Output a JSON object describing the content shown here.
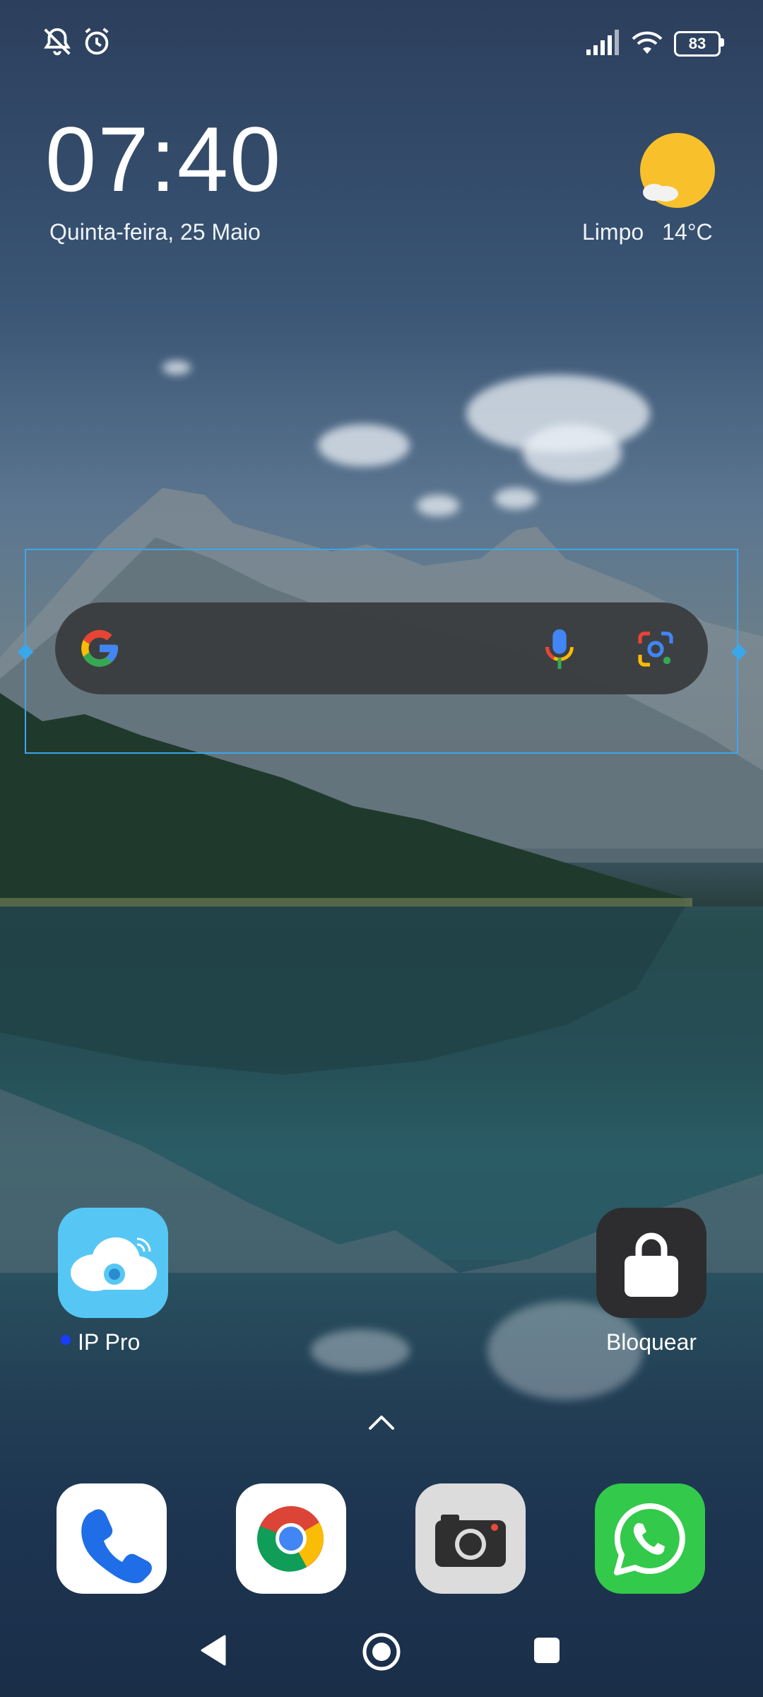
{
  "status_bar": {
    "left_icons": [
      "notifications-off-icon",
      "alarm-icon"
    ],
    "right_icons": [
      "signal-icon",
      "wifi-icon",
      "battery-icon"
    ],
    "battery_level": "83"
  },
  "clock_widget": {
    "time": "07:40",
    "date": "Quinta-feira, 25 Maio",
    "weather_condition": "Limpo",
    "temperature": "14°C",
    "weather_icon": "sun-with-cloud-icon"
  },
  "search_widget": {
    "logo": "google-g-icon",
    "voice_icon": "microphone-icon",
    "lens_icon": "google-lens-icon",
    "colors": {
      "blue": "#4285F4",
      "red": "#EA4335",
      "yellow": "#FBBC05",
      "green": "#34A853"
    }
  },
  "home_apps": [
    {
      "label": "IP Pro",
      "icon": "cloud-camera-icon",
      "has_new_dot": true
    },
    {
      "label": "Bloquear",
      "icon": "lock-icon"
    }
  ],
  "dock": [
    {
      "name": "Phone",
      "icon": "phone-icon"
    },
    {
      "name": "Chrome",
      "icon": "chrome-icon"
    },
    {
      "name": "Camera",
      "icon": "camera-icon"
    },
    {
      "name": "WhatsApp",
      "icon": "whatsapp-icon"
    }
  ],
  "app_drawer_hint": "chevron-up-icon",
  "nav_bar": [
    "back-icon",
    "home-icon",
    "recents-icon"
  ]
}
